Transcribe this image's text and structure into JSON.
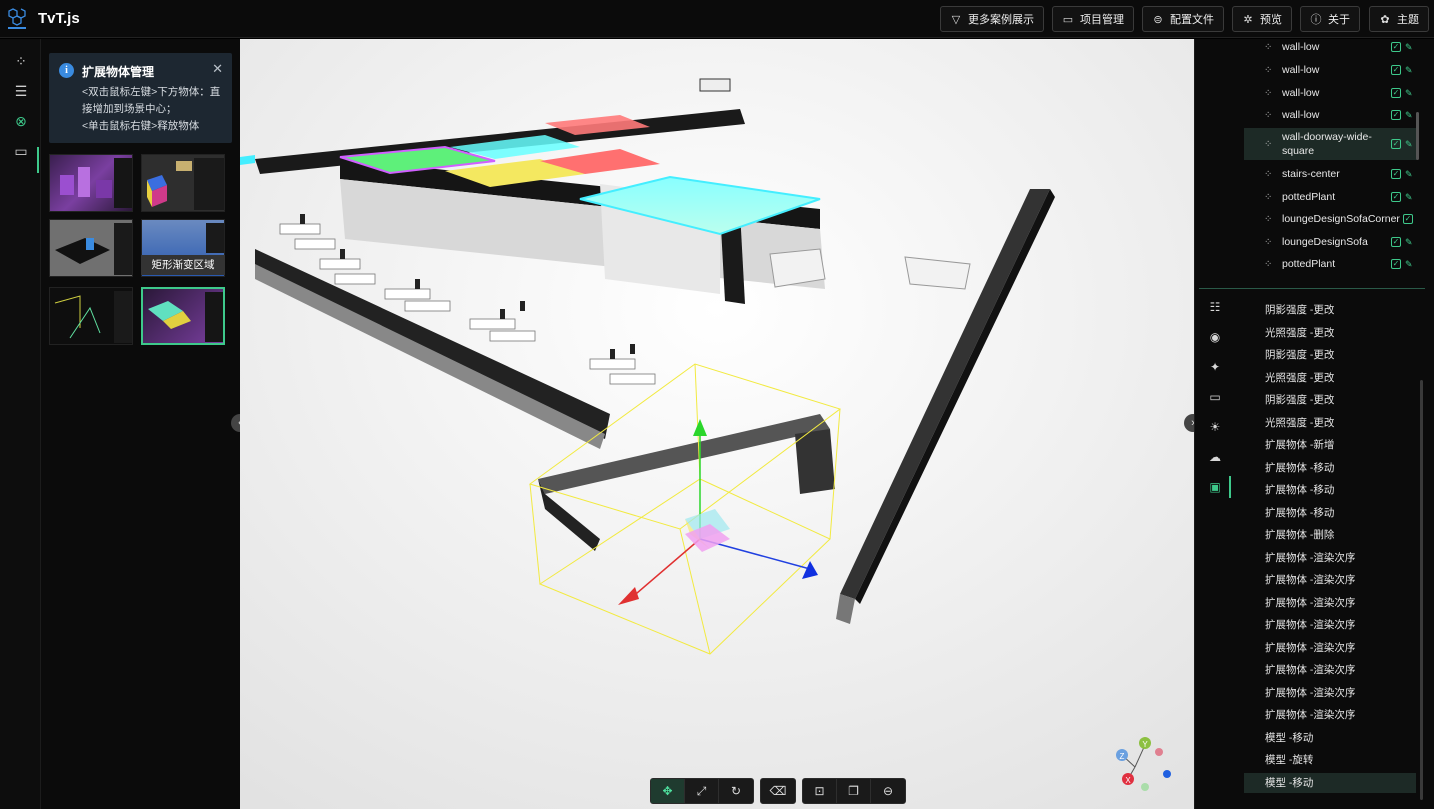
{
  "app": {
    "title": "TvT.js"
  },
  "header_buttons": [
    {
      "label": "更多案例展示",
      "icon": "filter-icon"
    },
    {
      "label": "项目管理",
      "icon": "folder-icon"
    },
    {
      "label": "配置文件",
      "icon": "config-icon"
    },
    {
      "label": "预览",
      "icon": "preview-icon"
    },
    {
      "label": "关于",
      "icon": "info-icon"
    },
    {
      "label": "主题",
      "icon": "theme-icon"
    }
  ],
  "info_card": {
    "title": "扩展物体管理",
    "line1": "<双击鼠标左键>下方物体：直接增加到场景中心；",
    "line2": "<单击鼠标右键>释放物体"
  },
  "thumbnails": {
    "tooltip": "矩形渐变区域"
  },
  "scene_tree": [
    {
      "label": "wall-low"
    },
    {
      "label": "wall-low"
    },
    {
      "label": "wall-low"
    },
    {
      "label": "wall-low"
    },
    {
      "label": "wall-doorway-wide-square",
      "selected": true
    },
    {
      "label": "stairs-center"
    },
    {
      "label": "pottedPlant"
    },
    {
      "label": "loungeDesignSofaCorner"
    },
    {
      "label": "loungeDesignSofa"
    },
    {
      "label": "pottedPlant"
    }
  ],
  "history": [
    "阴影强度 -更改",
    "光照强度 -更改",
    "阴影强度 -更改",
    "光照强度 -更改",
    "阴影强度 -更改",
    "光照强度 -更改",
    "扩展物体 -新增",
    "扩展物体 -移动",
    "扩展物体 -移动",
    "扩展物体 -移动",
    "扩展物体 -删除",
    "扩展物体 -渲染次序",
    "扩展物体 -渲染次序",
    "扩展物体 -渲染次序",
    "扩展物体 -渲染次序",
    "扩展物体 -渲染次序",
    "扩展物体 -渲染次序",
    "扩展物体 -渲染次序",
    "扩展物体 -渲染次序",
    "模型 -移动",
    "模型 -旋转",
    "模型 -移动"
  ],
  "axis_labels": {
    "x": "X",
    "y": "Y",
    "z": "Z"
  },
  "colors": {
    "accent": "#3ec98b",
    "info": "#3a8be0"
  }
}
